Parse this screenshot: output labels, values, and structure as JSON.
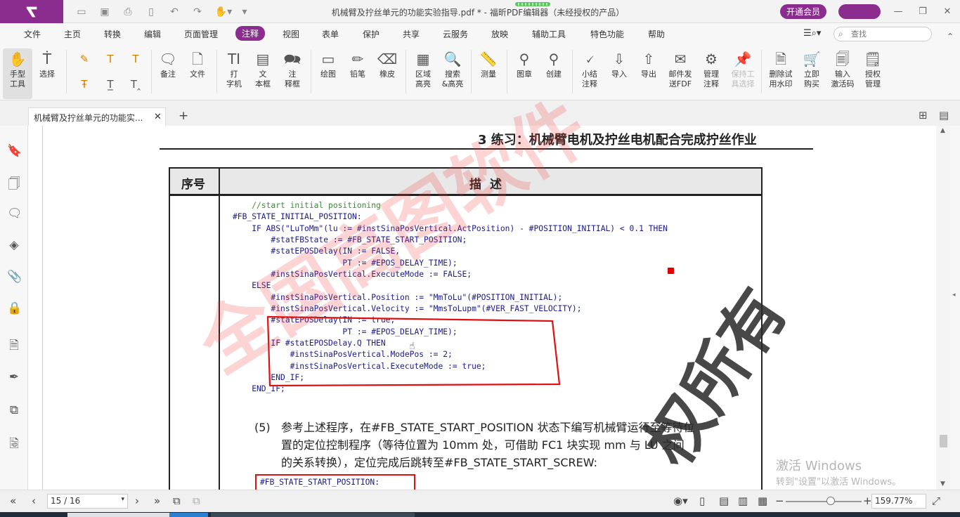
{
  "app": {
    "window_title": "机械臂及拧丝单元的功能实验指导.pdf * - 福昕PDF编辑器（未经授权的产品）",
    "vip_button": "开通会员",
    "minimize": "—",
    "restore": "❐",
    "close": "✕"
  },
  "menus": [
    "文件",
    "主页",
    "转换",
    "编辑",
    "页面管理",
    "注释",
    "视图",
    "表单",
    "保护",
    "共享",
    "云服务",
    "放映",
    "辅助工具",
    "特色功能",
    "帮助"
  ],
  "active_menu": "注释",
  "search": {
    "placeholder": "查找"
  },
  "ribbon": {
    "hand": "手型\n工具",
    "select": "选择",
    "note": "备注",
    "file": "文件",
    "typewriter": "打\n字机",
    "textbox": "文\n本框",
    "callout": "注\n释框",
    "drawing": "绘图",
    "pencil": "铅笔",
    "eraser": "橡皮",
    "area_highlight": "区域\n高亮",
    "search_highlight": "搜索\n&高亮",
    "measure": "测量",
    "stamp": "图章",
    "create": "创建",
    "summarize": "小结\n注释",
    "import": "导入",
    "export": "导出",
    "email_fdf": "邮件发\n送FDF",
    "manage_comments": "管理\n注释",
    "keep_tool": "保持工\n具选择",
    "remove_watermark": "删除试\n用水印",
    "buy_now": "立即\n购买",
    "activation_code": "输入\n激活码",
    "license": "授权\n管理"
  },
  "tabs": {
    "doc_tab": "机械臂及拧丝单元的功能实...",
    "close": "✕",
    "new": "+"
  },
  "document": {
    "section_heading": "3 练习：机械臂电机及拧丝电机配合完成拧丝作业",
    "col_index": "序号",
    "col_desc": "描述",
    "code_lines": [
      "    //start initial positioning",
      "#FB_STATE_INITIAL_POSITION:",
      "    IF ABS(\"LuToMm\"(lu := #instSinaPosVertical.ActPosition) - #POSITION_INITIAL) < 0.1 THEN",
      "        #statFBState := #FB_STATE_START_POSITION;",
      "        #statEPOSDelay(IN := FALSE,",
      "                       PT := #EPOS_DELAY_TIME);",
      "        #instSinaPosVertical.ExecuteMode := FALSE;",
      "    ELSE",
      "        #instSinaPosVertical.Position := \"MmToLu\"(#POSITION_INITIAL);",
      "        #instSinaPosVertical.Velocity := \"MmsToLupm\"(#VER_FAST_VELOCITY);",
      "        #statEPOSDelay(IN := true,",
      "                       PT := #EPOS_DELAY_TIME);",
      "        IF #statEPOSDelay.Q THEN",
      "            #instSinaPosVertical.ModePos := 2;",
      "            #instSinaPosVertical.ExecuteMode := true;",
      "        END_IF;",
      "    END_IF;"
    ],
    "step_number": "(5)",
    "step_line1": "参考上述程序，在#FB_STATE_START_POSITION 状态下编写机械臂运行至等待位",
    "step_line2": "置的定位控制程序（等待位置为 10mm 处，可借助 FC1 块实现 mm 与 LU 之间",
    "step_line3": "的关系转换），定位完成后跳转至#FB_STATE_START_SCREW:",
    "boxed_code": "#FB_STATE_START_POSITION:"
  },
  "watermarks": {
    "main": "全国高图软件",
    "corner": "权所有"
  },
  "activation": {
    "line1": "激活 Windows",
    "line2": "转到\"设置\"以激活 Windows。"
  },
  "statusbar": {
    "page": "15 / 16",
    "zoom": "159.77%"
  },
  "colors": {
    "brand": "#8a2d8f",
    "annotation_red": "#e01010"
  }
}
